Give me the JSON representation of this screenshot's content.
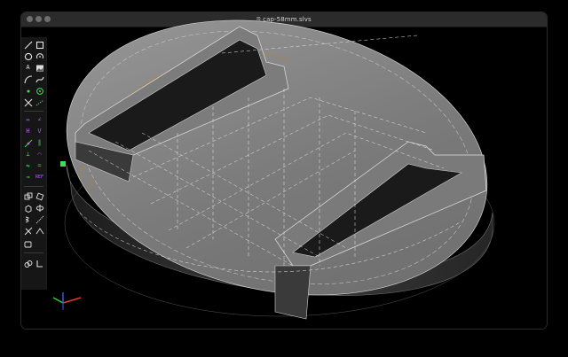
{
  "window": {
    "title": "cap-58mm.slvs",
    "title_icon": "document-icon"
  },
  "toolbar": {
    "groups": [
      [
        "line-icon",
        "rectangle-icon",
        "circle-icon",
        "arc-icon",
        "text-icon",
        "image-icon",
        "tangent-arc-icon",
        "bezier-icon",
        "point-icon",
        "workplane-point-icon",
        "split-icon",
        "construction-icon"
      ],
      [
        "distance-icon",
        "angle-icon",
        "horizontal-icon",
        "vertical-icon",
        "on-entity-icon",
        "parallel-icon",
        "perpendicular-icon",
        "tangent-icon",
        "symmetric-icon",
        "equal-icon",
        "midpoint-icon",
        "reference-icon"
      ],
      [
        "step-translate-icon",
        "step-rotate-icon",
        "extrude-icon",
        "revolve-icon",
        "helix-icon",
        "lathe-icon",
        "link-icon",
        "sketch-icon"
      ],
      [
        "nearest-iso-icon",
        "nearest-ortho-icon"
      ]
    ],
    "glyphs": {
      "text": "A",
      "reference": "REF",
      "distance": "↔",
      "angle": "∠",
      "horizontal": "H",
      "vertical": "V",
      "parallel": "∥",
      "perpendicular": "⊥",
      "tangent": "⌒",
      "symmetric": "⇋",
      "equal": "=",
      "midpoint": "⊸"
    }
  },
  "axes": {
    "x_color": "#e23b2e",
    "y_color": "#3ccb2f",
    "z_color": "#3b56e6"
  },
  "colors": {
    "accent_violet": "#b85cff",
    "tool_green": "#3fdc5a",
    "dashed_orange": "#c47a22",
    "surface_light": "#8a8a8a",
    "surface_dark": "#2c2c2c"
  }
}
